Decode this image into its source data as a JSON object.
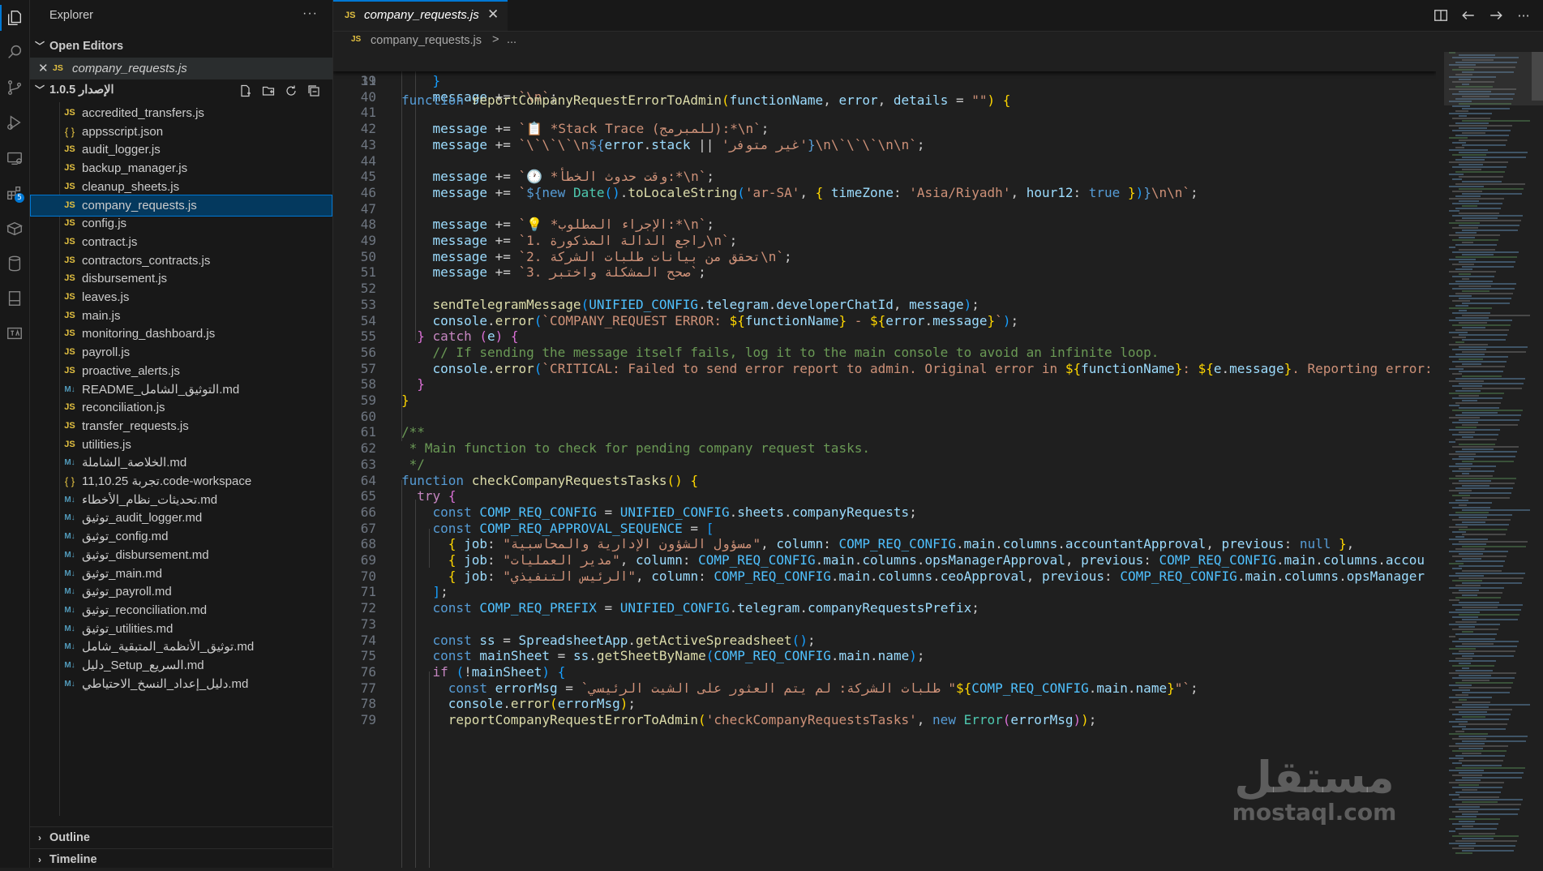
{
  "sidebar": {
    "title": "Explorer",
    "more": "···",
    "open_editors": {
      "label": "Open Editors",
      "items": [
        {
          "icon": "JS",
          "name": "company_requests.js"
        }
      ]
    },
    "folder": {
      "label": "الإصدار 1.0.5"
    },
    "files": [
      {
        "icon": "JS",
        "type": "js",
        "name": "accredited_transfers.js"
      },
      {
        "icon": "{ }",
        "type": "json",
        "name": "appsscript.json"
      },
      {
        "icon": "JS",
        "type": "js",
        "name": "audit_logger.js"
      },
      {
        "icon": "JS",
        "type": "js",
        "name": "backup_manager.js"
      },
      {
        "icon": "JS",
        "type": "js",
        "name": "cleanup_sheets.js"
      },
      {
        "icon": "JS",
        "type": "js",
        "name": "company_requests.js",
        "selected": true
      },
      {
        "icon": "JS",
        "type": "js",
        "name": "config.js"
      },
      {
        "icon": "JS",
        "type": "js",
        "name": "contract.js"
      },
      {
        "icon": "JS",
        "type": "js",
        "name": "contractors_contracts.js"
      },
      {
        "icon": "JS",
        "type": "js",
        "name": "disbursement.js"
      },
      {
        "icon": "JS",
        "type": "js",
        "name": "leaves.js"
      },
      {
        "icon": "JS",
        "type": "js",
        "name": "main.js"
      },
      {
        "icon": "JS",
        "type": "js",
        "name": "monitoring_dashboard.js"
      },
      {
        "icon": "JS",
        "type": "js",
        "name": "payroll.js"
      },
      {
        "icon": "JS",
        "type": "js",
        "name": "proactive_alerts.js"
      },
      {
        "icon": "M↓",
        "type": "md",
        "name": "README_التوثيق_الشامل.md"
      },
      {
        "icon": "JS",
        "type": "js",
        "name": "reconciliation.js"
      },
      {
        "icon": "JS",
        "type": "js",
        "name": "transfer_requests.js"
      },
      {
        "icon": "JS",
        "type": "js",
        "name": "utilities.js"
      },
      {
        "icon": "M↓",
        "type": "md",
        "name": "الخلاصة_الشاملة.md"
      },
      {
        "icon": "{ }",
        "type": "json",
        "name": "11,10.25 تجربة.code-workspace"
      },
      {
        "icon": "M↓",
        "type": "md",
        "name": "تحديثات_نظام_الأخطاء.md"
      },
      {
        "icon": "M↓",
        "type": "md",
        "name": "توثيق_audit_logger.md"
      },
      {
        "icon": "M↓",
        "type": "md",
        "name": "توثيق_config.md"
      },
      {
        "icon": "M↓",
        "type": "md",
        "name": "توثيق_disbursement.md"
      },
      {
        "icon": "M↓",
        "type": "md",
        "name": "توثيق_main.md"
      },
      {
        "icon": "M↓",
        "type": "md",
        "name": "توثيق_payroll.md"
      },
      {
        "icon": "M↓",
        "type": "md",
        "name": "توثيق_reconciliation.md"
      },
      {
        "icon": "M↓",
        "type": "md",
        "name": "توثيق_utilities.md"
      },
      {
        "icon": "M↓",
        "type": "md",
        "name": "توثيق_الأنظمة_المتبقية_شامل.md"
      },
      {
        "icon": "M↓",
        "type": "md",
        "name": "دليل_Setup_السريع.md"
      },
      {
        "icon": "M↓",
        "type": "md",
        "name": "دليل_إعداد_النسخ_الاحتياطي.md"
      }
    ],
    "outline_label": "Outline",
    "timeline_label": "Timeline"
  },
  "activity_bar": {
    "items": [
      "explorer-icon",
      "search-icon",
      "source-control-icon",
      "run-debug-icon",
      "remote-explorer-icon",
      "extensions-icon",
      "package-icon",
      "database-icon",
      "notebook-icon",
      "translate-icon"
    ],
    "extensions_badge": "5"
  },
  "editor": {
    "tab": {
      "icon": "JS",
      "name": "company_requests.js",
      "close": "✕"
    },
    "breadcrumb": {
      "icon": "JS",
      "file": "company_requests.js",
      "sep": ">",
      "more": "..."
    }
  },
  "code": {
    "sticky": {
      "num": "11",
      "html": "<span class='k'>function</span> <span class='f'>reportCompanyRequestErrorToAdmin</span><span class='br1'>(</span><span class='v'>functionName</span>, <span class='v'>error</span>, <span class='v'>details</span> = <span class='s'>\"\"</span><span class='br1'>)</span> <span class='br1'>{</span>"
    },
    "lines": [
      {
        "num": "39",
        "html": "    <span class='br3'>}</span>"
      },
      {
        "num": "40",
        "html": "    <span class='v'>message</span> += <span class='s'>`\\n`</span>;"
      },
      {
        "num": "41",
        "html": ""
      },
      {
        "num": "42",
        "html": "    <span class='v'>message</span> += <span class='s'>`📋 *Stack Trace (للمبرمج):*\\n`</span>;"
      },
      {
        "num": "43",
        "html": "    <span class='v'>message</span> += <span class='s'>`\\`\\`\\`\\n</span><span class='ph'>${</span><span class='v'>error</span>.<span class='v'>stack</span> || <span class='s'>'غير متوفر'</span><span class='ph'>}</span><span class='s'>\\n\\`\\`\\`\\n\\n`</span>;"
      },
      {
        "num": "44",
        "html": ""
      },
      {
        "num": "45",
        "html": "    <span class='v'>message</span> += <span class='s'>`🕐 *وقت حدوث الخطأ:*\\n`</span>;"
      },
      {
        "num": "46",
        "html": "    <span class='v'>message</span> += <span class='s'>`</span><span class='ph'>${</span><span class='k'>new</span> <span class='t'>Date</span><span class='br3'>(</span><span class='br3'>)</span>.<span class='f'>toLocaleString</span><span class='br3'>(</span><span class='s'>'ar-SA'</span>, <span class='br1'>{</span> <span class='v'>timeZone</span>: <span class='s'>'Asia/Riyadh'</span>, <span class='v'>hour12</span>: <span class='k'>true</span> <span class='br1'>}</span><span class='br3'>)</span><span class='ph'>}</span><span class='s'>\\n\\n`</span>;"
      },
      {
        "num": "47",
        "html": ""
      },
      {
        "num": "48",
        "html": "    <span class='v'>message</span> += <span class='s'>`💡 *الإجراء المطلوب:*\\n`</span>;"
      },
      {
        "num": "49",
        "html": "    <span class='v'>message</span> += <span class='s'>`1. راجع الدالة المذكورة\\n`</span>;"
      },
      {
        "num": "50",
        "html": "    <span class='v'>message</span> += <span class='s'>`2. تحقق من بيانات طلبات الشركة\\n`</span>;"
      },
      {
        "num": "51",
        "html": "    <span class='v'>message</span> += <span class='s'>`3. صحح المشكلة واختبر`</span>;"
      },
      {
        "num": "52",
        "html": ""
      },
      {
        "num": "53",
        "html": "    <span class='f'>sendTelegramMessage</span><span class='br3'>(</span><span class='c'>UNIFIED_CONFIG</span>.<span class='v'>telegram</span>.<span class='v'>developerChatId</span>, <span class='v'>message</span><span class='br3'>)</span>;"
      },
      {
        "num": "54",
        "html": "    <span class='v'>console</span>.<span class='f'>error</span><span class='br3'>(</span><span class='s'>`COMPANY_REQUEST ERROR: </span><span class='br1'>${</span><span class='v'>functionName</span><span class='br1'>}</span><span class='s'> - </span><span class='br1'>${</span><span class='v'>error</span>.<span class='v'>message</span><span class='br1'>}</span><span class='s'>`</span><span class='br3'>)</span>;"
      },
      {
        "num": "55",
        "html": "  <span class='br2'>}</span> <span class='kc'>catch</span> <span class='br2'>(</span><span class='v'>e</span><span class='br2'>)</span> <span class='br2'>{</span>"
      },
      {
        "num": "56",
        "html": "    <span class='cm'>// If sending the message itself fails, log it to the main console to avoid an infinite loop.</span>"
      },
      {
        "num": "57",
        "html": "    <span class='v'>console</span>.<span class='f'>error</span><span class='br3'>(</span><span class='s'>`CRITICAL: Failed to send error report to admin. Original error in </span><span class='br1'>${</span><span class='v'>functionName</span><span class='br1'>}</span><span class='s'>: </span><span class='br1'>${</span><span class='v'>e</span>.<span class='v'>message</span><span class='br1'>}</span><span class='s'>. Reporting error: </span>"
      },
      {
        "num": "58",
        "html": "  <span class='br2'>}</span>"
      },
      {
        "num": "59",
        "html": "<span class='br1'>}</span>"
      },
      {
        "num": "60",
        "html": ""
      },
      {
        "num": "61",
        "html": "<span class='cm'>/**</span>"
      },
      {
        "num": "62",
        "html": "<span class='cm'> * Main function to check for pending company request tasks.</span>"
      },
      {
        "num": "63",
        "html": "<span class='cm'> */</span>"
      },
      {
        "num": "64",
        "html": "<span class='k'>function</span> <span class='f'>checkCompanyRequestsTasks</span><span class='br1'>(</span><span class='br1'>)</span> <span class='br1'>{</span>"
      },
      {
        "num": "65",
        "html": "  <span class='kc'>try</span> <span class='br2'>{</span>"
      },
      {
        "num": "66",
        "html": "    <span class='k'>const</span> <span class='c'>COMP_REQ_CONFIG</span> = <span class='c'>UNIFIED_CONFIG</span>.<span class='v'>sheets</span>.<span class='v'>companyRequests</span>;"
      },
      {
        "num": "67",
        "html": "    <span class='k'>const</span> <span class='c'>COMP_REQ_APPROVAL_SEQUENCE</span> = <span class='br3'>[</span>"
      },
      {
        "num": "68",
        "html": "      <span class='br1'>{</span> <span class='v'>job</span>: <span class='s'>\"مسؤول الشؤون الإدارية والمحاسبية\"</span>, <span class='v'>column</span>: <span class='c'>COMP_REQ_CONFIG</span>.<span class='v'>main</span>.<span class='v'>columns</span>.<span class='v'>accountantApproval</span>, <span class='v'>previous</span>: <span class='k'>null</span> <span class='br1'>}</span>,"
      },
      {
        "num": "69",
        "html": "      <span class='br1'>{</span> <span class='v'>job</span>: <span class='s'>\"مدير العمليات\"</span>, <span class='v'>column</span>: <span class='c'>COMP_REQ_CONFIG</span>.<span class='v'>main</span>.<span class='v'>columns</span>.<span class='v'>opsManagerApproval</span>, <span class='v'>previous</span>: <span class='c'>COMP_REQ_CONFIG</span>.<span class='v'>main</span>.<span class='v'>columns</span>.<span class='v'>accou</span>"
      },
      {
        "num": "70",
        "html": "      <span class='br1'>{</span> <span class='v'>job</span>: <span class='s'>\"الرئيس التنفيذي\"</span>, <span class='v'>column</span>: <span class='c'>COMP_REQ_CONFIG</span>.<span class='v'>main</span>.<span class='v'>columns</span>.<span class='v'>ceoApproval</span>, <span class='v'>previous</span>: <span class='c'>COMP_REQ_CONFIG</span>.<span class='v'>main</span>.<span class='v'>columns</span>.<span class='v'>opsManager</span>"
      },
      {
        "num": "71",
        "html": "    <span class='br3'>]</span>;"
      },
      {
        "num": "72",
        "html": "    <span class='k'>const</span> <span class='c'>COMP_REQ_PREFIX</span> = <span class='c'>UNIFIED_CONFIG</span>.<span class='v'>telegram</span>.<span class='v'>companyRequestsPrefix</span>;"
      },
      {
        "num": "73",
        "html": ""
      },
      {
        "num": "74",
        "html": "    <span class='k'>const</span> <span class='v'>ss</span> = <span class='v'>SpreadsheetApp</span>.<span class='f'>getActiveSpreadsheet</span><span class='br3'>(</span><span class='br3'>)</span>;"
      },
      {
        "num": "75",
        "html": "    <span class='k'>const</span> <span class='v'>mainSheet</span> = <span class='v'>ss</span>.<span class='f'>getSheetByName</span><span class='br3'>(</span><span class='c'>COMP_REQ_CONFIG</span>.<span class='v'>main</span>.<span class='v'>name</span><span class='br3'>)</span>;"
      },
      {
        "num": "76",
        "html": "    <span class='kc'>if</span> <span class='br3'>(</span>!<span class='v'>mainSheet</span><span class='br3'>)</span> <span class='br3'>{</span>"
      },
      {
        "num": "77",
        "html": "      <span class='k'>const</span> <span class='v'>errorMsg</span> = <span class='s'>`طلبات الشركة: لم يتم العثور على الشيت الرئيسي \"</span><span class='br1'>${</span><span class='c'>COMP_REQ_CONFIG</span>.<span class='v'>main</span>.<span class='v'>name</span><span class='br1'>}</span><span class='s'>\"`</span>;"
      },
      {
        "num": "78",
        "html": "      <span class='v'>console</span>.<span class='f'>error</span><span class='br1'>(</span><span class='v'>errorMsg</span><span class='br1'>)</span>;"
      },
      {
        "num": "79",
        "html": "      <span class='f'>reportCompanyRequestErrorToAdmin</span><span class='br1'>(</span><span class='s'>'checkCompanyRequestsTasks'</span>, <span class='k'>new</span> <span class='t'>Error</span><span class='br2'>(</span><span class='v'>errorMsg</span><span class='br2'>)</span><span class='br1'>)</span>;"
      }
    ]
  },
  "watermark": {
    "arabic": "مستقل",
    "latin": "mostaql.com"
  }
}
